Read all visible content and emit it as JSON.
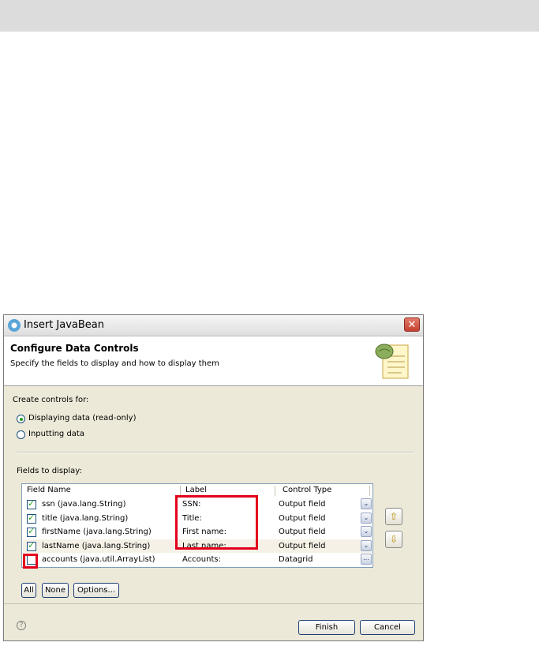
{
  "dialog": {
    "title": "Insert JavaBean",
    "close_label": "✕"
  },
  "banner": {
    "title": "Configure Data Controls",
    "subtitle": "Specify the fields to display and how to display them"
  },
  "create_controls": {
    "label": "Create controls for:",
    "options": [
      {
        "label": "Displaying data (read-only)",
        "selected": true
      },
      {
        "label": "Inputting data",
        "selected": false
      }
    ]
  },
  "fields": {
    "label": "Fields to display:",
    "columns": [
      "Field Name",
      "Label",
      "Control Type"
    ],
    "rows": [
      {
        "checked": true,
        "field": "ssn (java.lang.String)",
        "label": "SSN:",
        "control": "Output field",
        "action": "dropdown"
      },
      {
        "checked": true,
        "field": "title (java.lang.String)",
        "label": "Title:",
        "control": "Output field",
        "action": "dropdown"
      },
      {
        "checked": true,
        "field": "firstName (java.lang.String)",
        "label": "First name:",
        "control": "Output field",
        "action": "dropdown"
      },
      {
        "checked": true,
        "field": "lastName (java.lang.String)",
        "label": "Last name:",
        "control": "Output field",
        "action": "dropdown"
      },
      {
        "checked": false,
        "field": "accounts (java.util.ArrayList)",
        "label": "Accounts:",
        "control": "Datagrid",
        "action": "ellipsis"
      }
    ]
  },
  "buttons": {
    "all": "All",
    "none": "None",
    "options": "Options...",
    "finish": "Finish",
    "cancel": "Cancel",
    "help": "?",
    "move_up": "⇧",
    "move_down": "⇩",
    "dropdown": "⌄",
    "ellipsis": "..."
  },
  "colors": {
    "highlight_box": "#e3001b",
    "accent": "#21a121"
  }
}
